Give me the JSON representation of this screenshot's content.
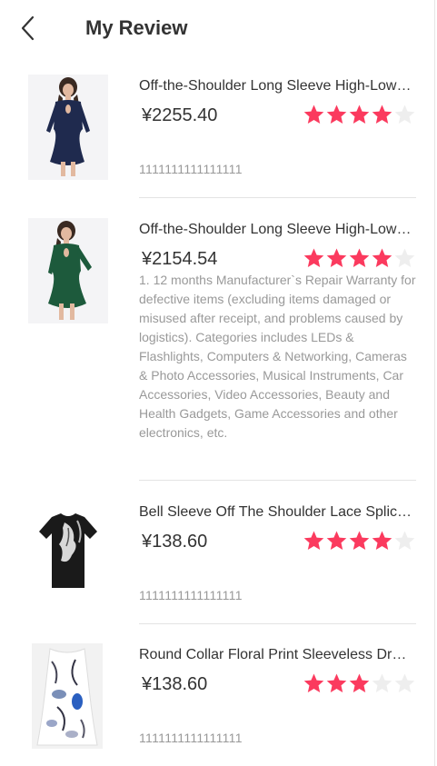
{
  "header": {
    "back_icon": "chevron-left-icon",
    "title": "My Review"
  },
  "colors": {
    "star_filled": "#fb3a5e",
    "star_empty": "#eeeeee",
    "text_primary": "#333333",
    "text_secondary": "#999999"
  },
  "reviews": [
    {
      "name": "Off-the-Shoulder Long Sleeve High-Low Dress",
      "price": "¥2255.40",
      "rating": 4,
      "comment": "1111111111111111",
      "image": "navy-dress-image"
    },
    {
      "name": "Off-the-Shoulder Long Sleeve High-Low Dress",
      "price": "¥2154.54",
      "rating": 4,
      "comment": "1. 12 months Manufacturer`s Repair Warranty for defective items (excluding items damaged or misused after receipt, and problems caused by logistics). Categories includes LEDs & Flashlights, Computers & Networking, Cameras & Photo Accessories, Musical Instruments, Car Accessories, Video Accessories, Beauty and Health Gadgets, Game Accessories and other electronics, etc.",
      "image": "green-dress-image"
    },
    {
      "name": "Bell Sleeve Off The Shoulder Lace Splicing Dress",
      "price": "¥138.60",
      "rating": 4,
      "comment": "1111111111111111",
      "image": "black-tshirt-image"
    },
    {
      "name": "Round Collar Floral Print Sleeveless Dress",
      "price": "¥138.60",
      "rating": 3,
      "comment": "1111111111111111",
      "image": "floral-dress-image"
    }
  ]
}
